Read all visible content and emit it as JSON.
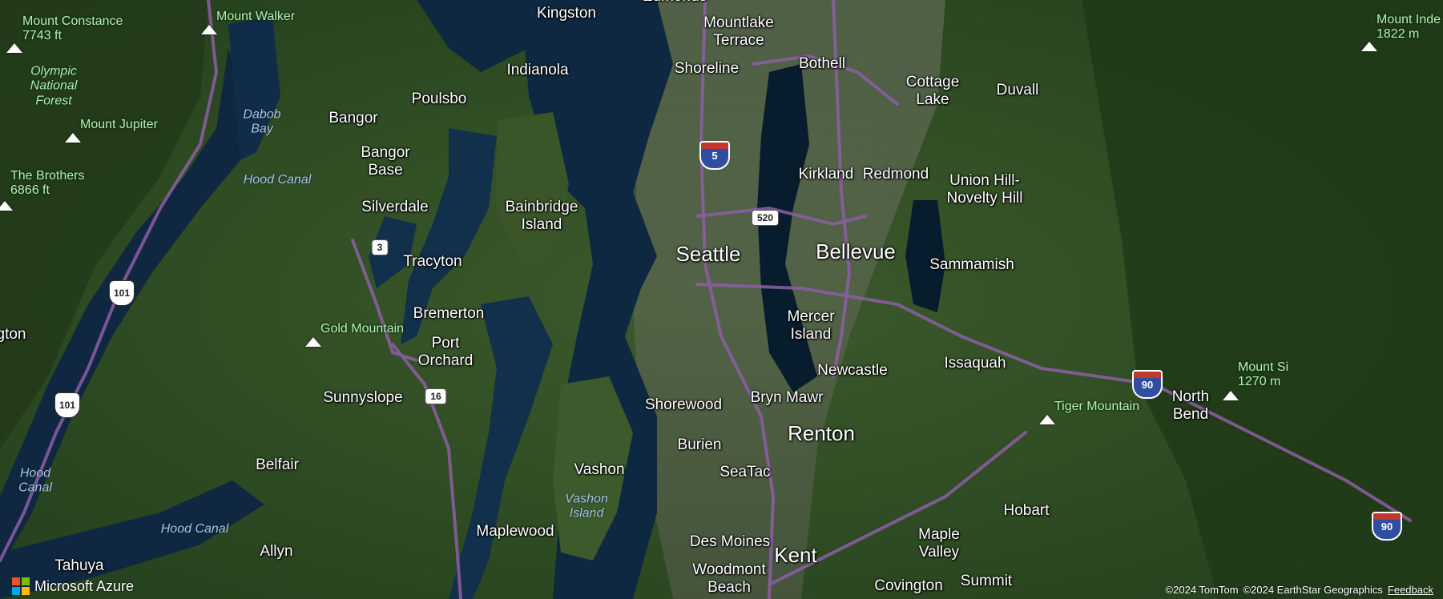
{
  "map": {
    "cities": [
      {
        "id": "kingston",
        "label": "Kingston"
      },
      {
        "id": "edmonds",
        "label": "Edmonds"
      },
      {
        "id": "mountlake-terrace",
        "label": "Mountlake\nTerrace"
      },
      {
        "id": "shoreline",
        "label": "Shoreline"
      },
      {
        "id": "bothell",
        "label": "Bothell"
      },
      {
        "id": "cottage-lake",
        "label": "Cottage\nLake"
      },
      {
        "id": "duvall",
        "label": "Duvall"
      },
      {
        "id": "indianola",
        "label": "Indianola"
      },
      {
        "id": "poulsbo",
        "label": "Poulsbo"
      },
      {
        "id": "bangor",
        "label": "Bangor"
      },
      {
        "id": "bangor-base",
        "label": "Bangor\nBase"
      },
      {
        "id": "silverdale",
        "label": "Silverdale"
      },
      {
        "id": "bainbridge-island",
        "label": "Bainbridge\nIsland"
      },
      {
        "id": "kirkland",
        "label": "Kirkland"
      },
      {
        "id": "redmond",
        "label": "Redmond"
      },
      {
        "id": "union-hill",
        "label": "Union Hill-\nNovelty Hill"
      },
      {
        "id": "seattle",
        "label": "Seattle",
        "big": true
      },
      {
        "id": "bellevue",
        "label": "Bellevue",
        "big": true
      },
      {
        "id": "sammamish",
        "label": "Sammamish"
      },
      {
        "id": "tracyton",
        "label": "Tracyton"
      },
      {
        "id": "bremerton",
        "label": "Bremerton"
      },
      {
        "id": "port-orchard",
        "label": "Port\nOrchard"
      },
      {
        "id": "mercer-island",
        "label": "Mercer\nIsland"
      },
      {
        "id": "newcastle",
        "label": "Newcastle"
      },
      {
        "id": "issaquah",
        "label": "Issaquah"
      },
      {
        "id": "sunnyslope",
        "label": "Sunnyslope"
      },
      {
        "id": "shorewood",
        "label": "Shorewood"
      },
      {
        "id": "bryn-mawr",
        "label": "Bryn Mawr"
      },
      {
        "id": "renton",
        "label": "Renton",
        "big": true
      },
      {
        "id": "north-bend",
        "label": "North\nBend"
      },
      {
        "id": "burien",
        "label": "Burien"
      },
      {
        "id": "seatac",
        "label": "SeaTac"
      },
      {
        "id": "belfair",
        "label": "Belfair"
      },
      {
        "id": "vashon",
        "label": "Vashon"
      },
      {
        "id": "hobart",
        "label": "Hobart"
      },
      {
        "id": "maplewood",
        "label": "Maplewood"
      },
      {
        "id": "maple-valley",
        "label": "Maple\nValley"
      },
      {
        "id": "des-moines",
        "label": "Des Moines"
      },
      {
        "id": "kent",
        "label": "Kent",
        "big": true
      },
      {
        "id": "tahuya",
        "label": "Tahuya"
      },
      {
        "id": "allyn",
        "label": "Allyn"
      },
      {
        "id": "woodmont-beach",
        "label": "Woodmont\nBeach"
      },
      {
        "id": "covington",
        "label": "Covington"
      },
      {
        "id": "summit",
        "label": "Summit"
      },
      {
        "id": "edge-west",
        "label": "gton"
      }
    ],
    "water": [
      {
        "id": "dabob-bay",
        "label": "Dabob\nBay"
      },
      {
        "id": "hood-canal-1",
        "label": "Hood Canal"
      },
      {
        "id": "hood-canal-2",
        "label": "Hood\nCanal"
      },
      {
        "id": "hood-canal-3",
        "label": "Hood Canal"
      },
      {
        "id": "vashon-island",
        "label": "Vashon\nIsland"
      }
    ],
    "parks": [
      {
        "id": "olympic-nf",
        "label": "Olympic\nNational\nForest"
      }
    ],
    "peaks": [
      {
        "id": "mount-constance",
        "label": "Mount Constance\n7743 ft"
      },
      {
        "id": "mount-walker",
        "label": "Mount Walker"
      },
      {
        "id": "mount-jupiter",
        "label": "Mount Jupiter"
      },
      {
        "id": "the-brothers",
        "label": "The Brothers\n6866 ft"
      },
      {
        "id": "gold-mountain",
        "label": "Gold Mountain"
      },
      {
        "id": "tiger-mountain",
        "label": "Tiger Mountain"
      },
      {
        "id": "mount-si",
        "label": "Mount Si\n1270 m"
      },
      {
        "id": "mount-index",
        "label": "Mount Inde\n1822 m"
      }
    ],
    "shields": [
      {
        "id": "i5",
        "kind": "interstate",
        "label": "5"
      },
      {
        "id": "sr520",
        "kind": "state",
        "label": "520"
      },
      {
        "id": "sr3",
        "kind": "state",
        "label": "3"
      },
      {
        "id": "sr16",
        "kind": "state",
        "label": "16"
      },
      {
        "id": "us101-a",
        "kind": "us",
        "label": "101"
      },
      {
        "id": "us101-b",
        "kind": "us",
        "label": "101"
      },
      {
        "id": "i90-a",
        "kind": "interstate",
        "label": "90"
      },
      {
        "id": "i90-b",
        "kind": "interstate",
        "label": "90"
      }
    ]
  },
  "footer": {
    "logo_text": "Microsoft Azure",
    "logo_colors": [
      "#f25022",
      "#7fba00",
      "#00a4ef",
      "#ffb900"
    ],
    "attribution_tomtom": "©2024 TomTom",
    "attribution_earthstar": "©2024 EarthStar Geographics",
    "feedback_label": "Feedback"
  }
}
